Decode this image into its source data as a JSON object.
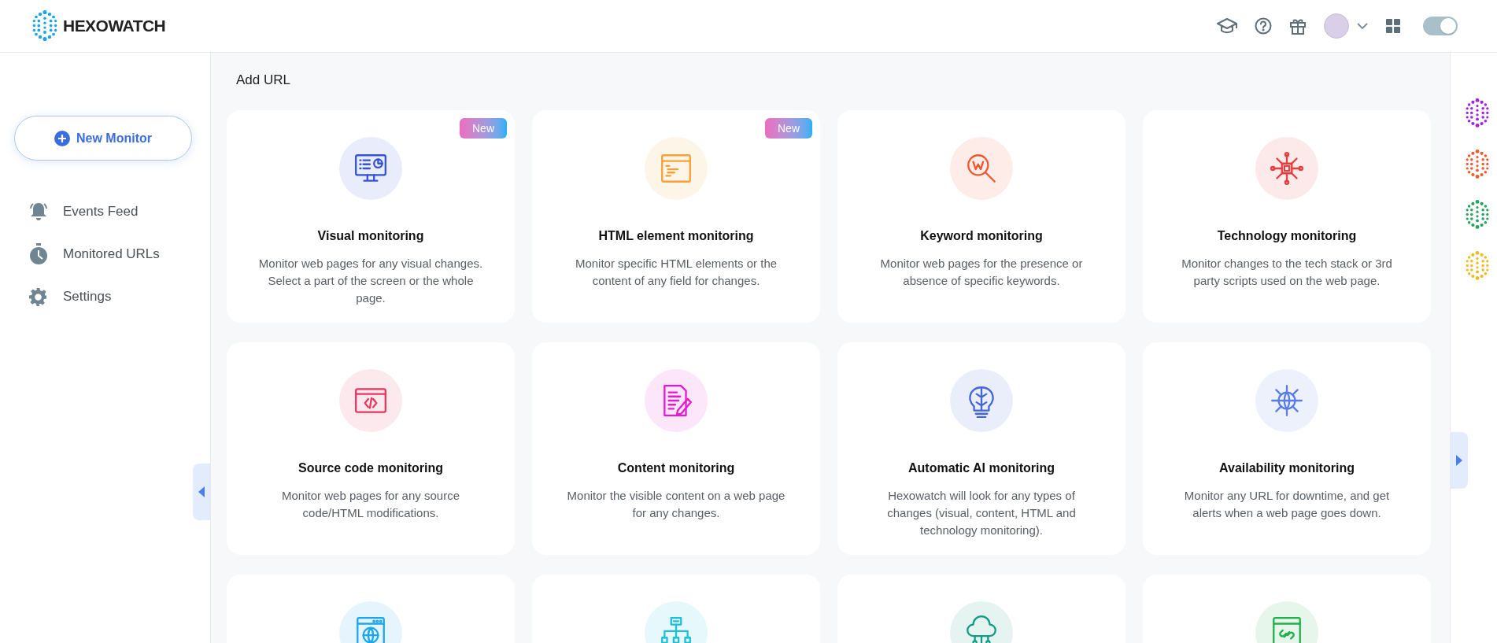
{
  "header": {
    "logo_text": "HEXOWATCH",
    "theme_toggle": {
      "on": true
    }
  },
  "sidebar": {
    "new_button": "New Monitor",
    "items": [
      {
        "label": "Events Feed"
      },
      {
        "label": "Monitored URLs"
      },
      {
        "label": "Settings"
      }
    ]
  },
  "page_title": "Add URL",
  "cards": [
    {
      "title": "Visual monitoring",
      "description": "Monitor web pages for any visual changes. Select a part of the screen or the whole page.",
      "badge": "New",
      "color": "#3552d8"
    },
    {
      "title": "HTML element monitoring",
      "description": "Monitor specific HTML elements or the content of any field for changes.",
      "badge": "New",
      "color": "#f7a035"
    },
    {
      "title": "Keyword monitoring",
      "description": "Monitor web pages for the presence or absence of specific keywords.",
      "color": "#f0552c"
    },
    {
      "title": "Technology monitoring",
      "description": "Monitor changes to the tech stack or 3rd party scripts used on the web page.",
      "color": "#e53e3e"
    },
    {
      "title": "Source code monitoring",
      "description": "Monitor web pages for any source code/HTML modifications.",
      "color": "#e8365d"
    },
    {
      "title": "Content monitoring",
      "description": "Monitor the visible content on a web page for any changes.",
      "color": "#e31bd0"
    },
    {
      "title": "Automatic AI monitoring",
      "description": "Hexowatch will look for any types of changes (visual, content, HTML and technology monitoring).",
      "color": "#4466dd"
    },
    {
      "title": "Availability monitoring",
      "description": "Monitor any URL for downtime, and get alerts when a web page goes down.",
      "color": "#5b7ce6"
    },
    {
      "color": "#1ba7f0"
    },
    {
      "color": "#1cc0d8"
    },
    {
      "color": "#0f9d84"
    },
    {
      "color": "#22b04b"
    }
  ],
  "app_switcher": [
    {
      "color": "#a21fe8"
    },
    {
      "color": "#ef5a2f"
    },
    {
      "color": "#21a35a"
    },
    {
      "color": "#f4b81c"
    }
  ]
}
